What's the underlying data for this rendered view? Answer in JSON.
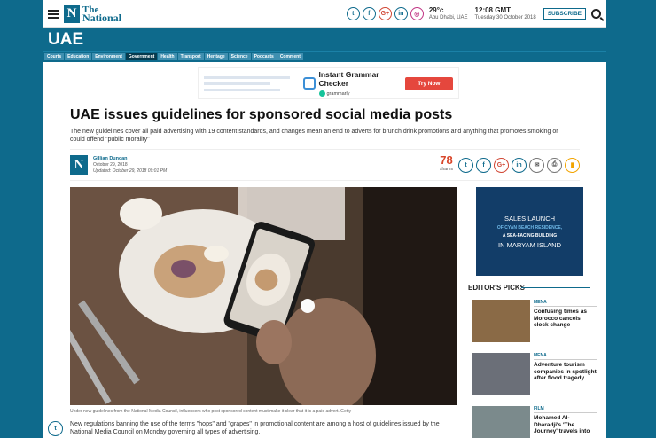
{
  "header": {
    "logo_mark": "N",
    "logo_line1": "The",
    "logo_line2": "National",
    "social": [
      {
        "name": "twitter-icon",
        "glyph": "t"
      },
      {
        "name": "facebook-icon",
        "glyph": "f"
      },
      {
        "name": "googleplus-icon",
        "glyph": "G+"
      },
      {
        "name": "linkedin-icon",
        "glyph": "in"
      },
      {
        "name": "instagram-icon",
        "glyph": "◎"
      }
    ],
    "weather_temp": "29°c",
    "weather_place": "Abu Dhabi, UAE",
    "time": "12:08",
    "time_suffix": "GMT",
    "date": "Tuesday 30 October 2018",
    "subscribe": "SUBSCRIBE"
  },
  "section": {
    "title": "UAE",
    "nav": [
      "Courts",
      "Education",
      "Environment",
      "Government",
      "Health",
      "Transport",
      "Heritage",
      "Science",
      "Podcasts",
      "Comment"
    ],
    "active": "Government"
  },
  "ad": {
    "title": "Instant Grammar Checker",
    "brand": "grammarly",
    "button": "Try Now"
  },
  "article": {
    "headline": "UAE issues guidelines for sponsored social media posts",
    "standfirst": "The new guidelines cover all paid advertising with 19 content standards, and changes mean an end to adverts for brunch drink promotions and anything that promotes smoking or could offend \"public morality\"",
    "author": "Gillian Duncan",
    "date": "October 29, 2018",
    "updated": "Updated: October 29, 2018 09:01 PM",
    "share_count": "78",
    "share_label": "shares",
    "caption": "Under new guidelines from the National Media Council, influencers who post sponsored content must make it clear that it is a paid advert. Getty",
    "body": "New regulations banning the use of the terms \"hops\" and \"grapes\" in promotional content are among a host of guidelines issued by the National Media Council on Monday governing all types of advertising."
  },
  "share_buttons": [
    {
      "name": "share-twitter-icon",
      "glyph": "t",
      "style": ""
    },
    {
      "name": "share-facebook-icon",
      "glyph": "f",
      "style": ""
    },
    {
      "name": "share-googleplus-icon",
      "glyph": "G+",
      "style": "gp"
    },
    {
      "name": "share-linkedin-icon",
      "glyph": "in",
      "style": ""
    },
    {
      "name": "share-email-icon",
      "glyph": "✉",
      "style": "grey"
    },
    {
      "name": "share-print-icon",
      "glyph": "⎙",
      "style": "grey"
    },
    {
      "name": "bookmark-icon",
      "glyph": "▮",
      "style": "bm"
    }
  ],
  "sidebar": {
    "ad_line1": "SALES LAUNCH",
    "ad_line2": "OF CYAN BEACH RESIDENCE,",
    "ad_line3": "A SEA-FACING BUILDING",
    "ad_line4": "IN MARYAM ISLAND",
    "editors_picks_title": "EDITOR'S PICKS",
    "picks": [
      {
        "category": "MENA",
        "title": "Confusing times as Morocco cancels clock change",
        "color": "#8a6a46"
      },
      {
        "category": "MENA",
        "title": "Adventure tourism companies in spotlight after flood tragedy",
        "color": "#6b6f78"
      },
      {
        "category": "FILM",
        "title": "Mohamed Al-Dharadji's 'The Journey' travels into",
        "color": "#7b8a8c"
      }
    ]
  },
  "colors": {
    "brand": "#0e6a8c",
    "share_count": "#d9472b",
    "ad_button": "#e5473d"
  }
}
